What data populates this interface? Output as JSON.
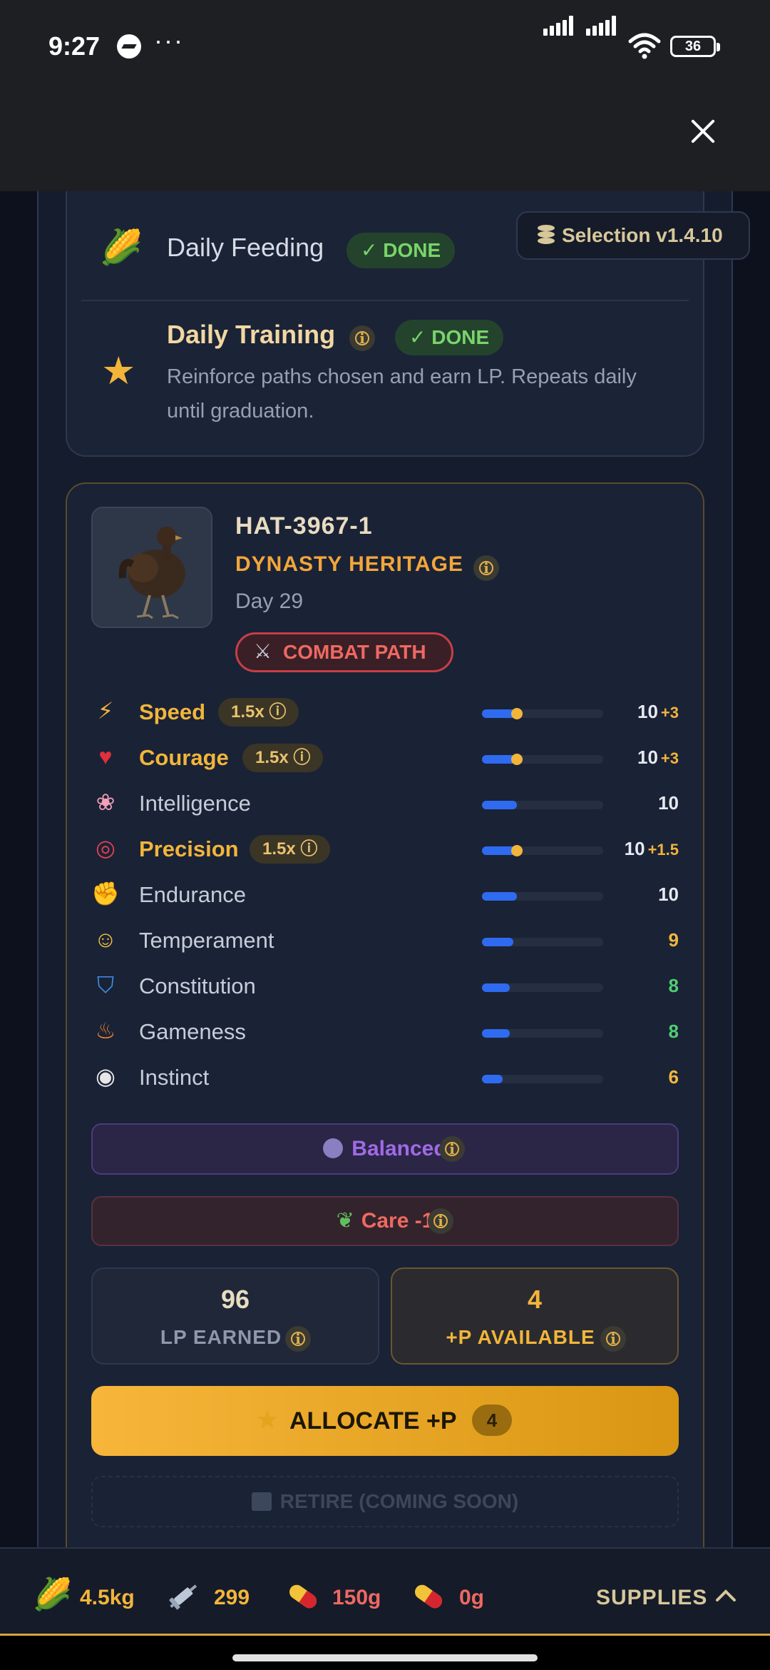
{
  "status_bar": {
    "time": "9:27",
    "dots": "···",
    "battery": "36"
  },
  "daily": {
    "feeding_label": "Daily Feeding",
    "feeding_status": "✓ DONE",
    "training_label": "Daily Training",
    "training_status": "✓ DONE",
    "training_desc": "Reinforce paths chosen and earn LP. Repeats daily until graduation.",
    "version": "Selection v1.4.10"
  },
  "chicken": {
    "id": "HAT-3967-1",
    "heritage": "DYNASTY HERITAGE",
    "day": "Day 29",
    "path": "COMBAT PATH"
  },
  "stats": [
    {
      "name": "Speed",
      "icon": "lightning-icon",
      "highlight": true,
      "mult": "1.5x",
      "value": "10",
      "bonus": "+3",
      "fill": 0.29,
      "dot": true,
      "value_color": "#e6e9f0"
    },
    {
      "name": "Courage",
      "icon": "heart-icon",
      "highlight": true,
      "mult": "1.5x",
      "value": "10",
      "bonus": "+3",
      "fill": 0.29,
      "dot": true,
      "value_color": "#e6e9f0"
    },
    {
      "name": "Intelligence",
      "icon": "brain-icon",
      "highlight": false,
      "mult": "",
      "value": "10",
      "bonus": "",
      "fill": 0.29,
      "dot": false,
      "value_color": "#e6e9f0"
    },
    {
      "name": "Precision",
      "icon": "target-icon",
      "highlight": true,
      "mult": "1.5x",
      "value": "10",
      "bonus": "+1.5",
      "fill": 0.29,
      "dot": true,
      "value_color": "#e6e9f0"
    },
    {
      "name": "Endurance",
      "icon": "flexed-arm-icon",
      "highlight": false,
      "mult": "",
      "value": "10",
      "bonus": "",
      "fill": 0.29,
      "dot": false,
      "value_color": "#e6e9f0"
    },
    {
      "name": "Temperament",
      "icon": "relieved-face-icon",
      "highlight": false,
      "mult": "",
      "value": "9",
      "bonus": "",
      "fill": 0.26,
      "dot": false,
      "value_color": "#f0b73e"
    },
    {
      "name": "Constitution",
      "icon": "shield-icon",
      "highlight": false,
      "mult": "",
      "value": "8",
      "bonus": "",
      "fill": 0.23,
      "dot": false,
      "value_color": "#4fce72"
    },
    {
      "name": "Gameness",
      "icon": "fire-icon",
      "highlight": false,
      "mult": "",
      "value": "8",
      "bonus": "",
      "fill": 0.23,
      "dot": false,
      "value_color": "#4fce72"
    },
    {
      "name": "Instinct",
      "icon": "eye-icon",
      "highlight": false,
      "mult": "",
      "value": "6",
      "bonus": "",
      "fill": 0.17,
      "dot": false,
      "value_color": "#f0b73e"
    }
  ],
  "balanced_label": "Balanced",
  "care_label": "Care -1",
  "lp": {
    "earned_value": "96",
    "earned_label": "LP EARNED",
    "available_value": "4",
    "available_label": "+P AVAILABLE"
  },
  "allocate": {
    "label": "ALLOCATE +P",
    "count": "4"
  },
  "retire_label": "RETIRE (COMING SOON)",
  "supplies": {
    "corn": "4.5kg",
    "syringe": "299",
    "pill_red": "150g",
    "pill_red2": "0g",
    "label": "SUPPLIES"
  },
  "colors": {
    "accent": "#f0b73e",
    "danger": "#ee6961",
    "purple": "#a06ae6",
    "blue_bar": "#2f6bf0"
  }
}
